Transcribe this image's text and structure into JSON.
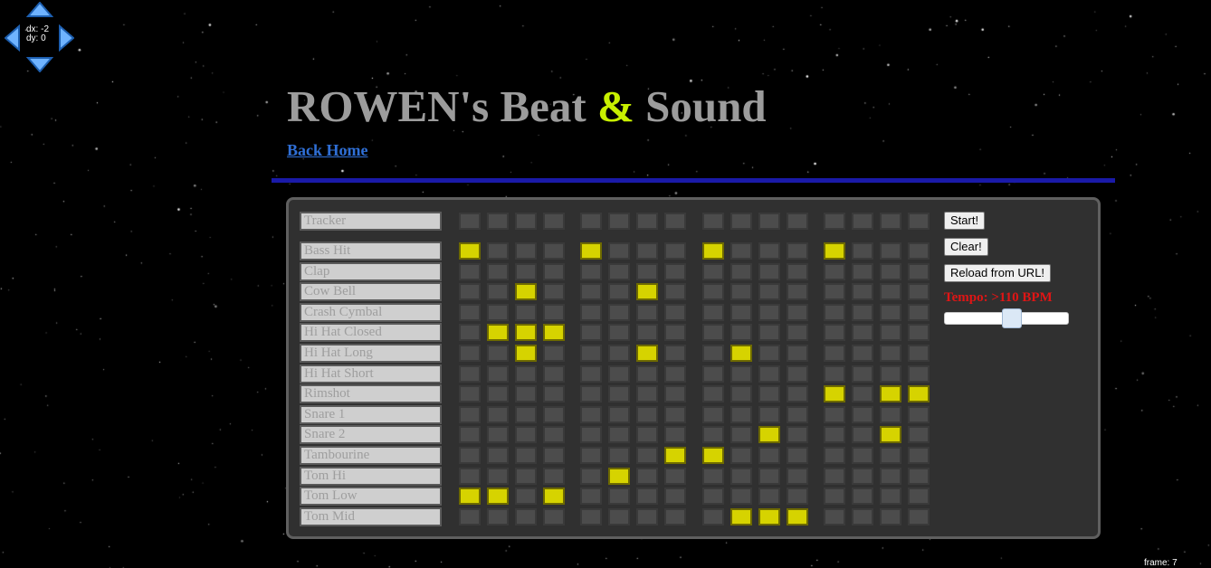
{
  "nav": {
    "dx_text": "dx: -2",
    "dy_text": "dy: 0"
  },
  "header": {
    "title_part1": "ROWEN's Beat ",
    "title_amp": "&",
    "title_part2": " Sound",
    "back_link": "Back Home"
  },
  "tracker": {
    "label": "Tracker",
    "steps": 16
  },
  "tracks": [
    {
      "label": "Bass Hit",
      "steps": [
        0,
        4,
        8,
        12
      ]
    },
    {
      "label": "Clap",
      "steps": []
    },
    {
      "label": "Cow Bell",
      "steps": [
        2,
        6
      ]
    },
    {
      "label": "Crash Cymbal",
      "steps": []
    },
    {
      "label": "Hi Hat Closed",
      "steps": [
        1,
        2,
        3
      ]
    },
    {
      "label": "Hi Hat Long",
      "steps": [
        2,
        6,
        9
      ]
    },
    {
      "label": "Hi Hat Short",
      "steps": []
    },
    {
      "label": "Rimshot",
      "steps": [
        12,
        14,
        15
      ]
    },
    {
      "label": "Snare 1",
      "steps": []
    },
    {
      "label": "Snare 2",
      "steps": [
        10,
        14
      ]
    },
    {
      "label": "Tambourine",
      "steps": [
        7,
        8
      ]
    },
    {
      "label": "Tom Hi",
      "steps": [
        5
      ]
    },
    {
      "label": "Tom Low",
      "steps": [
        0,
        1,
        3
      ]
    },
    {
      "label": "Tom Mid",
      "steps": [
        9,
        10,
        11
      ]
    }
  ],
  "controls": {
    "start_label": "Start!",
    "clear_label": "Clear!",
    "reload_label": "Reload from URL!",
    "tempo_label": "Tempo: >110 BPM",
    "tempo_slider_fraction": 0.55
  },
  "footer": {
    "frame_text": "frame: 7"
  },
  "colors": {
    "title": "#9c9c9c",
    "ampersand": "#c8f000",
    "link": "#2f6fd6",
    "divider": "#1a1aa8",
    "cell_on": "#d6d300",
    "cell_off": "#4c4c4c",
    "tempo": "#e01515"
  }
}
